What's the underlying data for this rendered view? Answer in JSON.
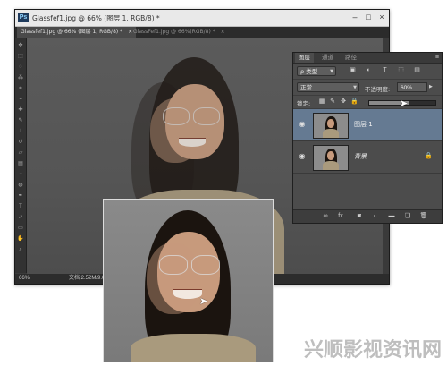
{
  "window": {
    "title": "Glassfef1.jpg @ 66% (图层 1, RGB/8) *",
    "min_glyph": "–",
    "max_glyph": "□",
    "close_glyph": "×"
  },
  "tabs": [
    {
      "label": "Glassfef1.jpg @ 66% (图层 1, RGB/8) *",
      "close": "×"
    },
    {
      "label": "GlassFef1.jpg @ 66%(RGB/8) *",
      "close": "×"
    }
  ],
  "status": {
    "zoom": "66%",
    "doc_info": "文档:2.52M/9.0M"
  },
  "layers_panel": {
    "tabs": [
      "图层",
      "通道",
      "路径"
    ],
    "menu_glyph": "≡",
    "kind_filter": "ρ 类型",
    "filter_icons": [
      "▣",
      "◐",
      "T",
      "⬚",
      "▤"
    ],
    "blend_mode": "正常",
    "opacity_label": "不透明度:",
    "opacity_value": "60%",
    "opacity_fraction": 0.6,
    "lock_label": "锁定:",
    "lock_icons": [
      "▦",
      "✎",
      "✥",
      "🔒"
    ],
    "layers": [
      {
        "name": "图层 1",
        "selected": true
      },
      {
        "name": "背景",
        "locked": true,
        "lock_glyph": "🔒"
      }
    ],
    "footer_icons": [
      "∞",
      "fx.",
      "◙",
      "◐",
      "▬",
      "❏",
      "🗑"
    ]
  },
  "watermark": "兴顺影视资讯网",
  "colors": {
    "accent_selected": "#657a92",
    "panel_bg": "#4c4c4c",
    "canvas_bg": "#555555"
  }
}
